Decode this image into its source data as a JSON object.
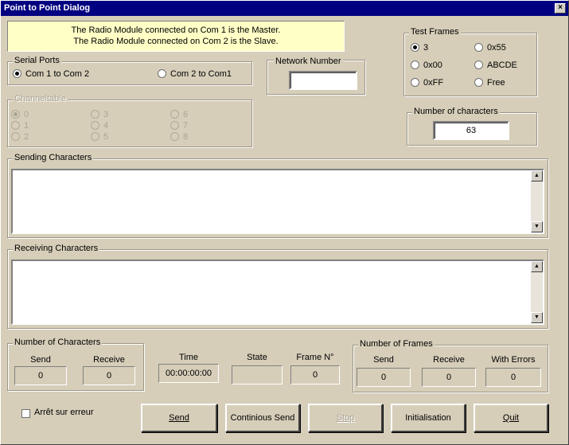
{
  "window": {
    "title": "Point to Point Dialog",
    "close_glyph": "×"
  },
  "info": {
    "line1": "The Radio Module connected on Com 1 is the Master.",
    "line2": "The Radio Module connected on Com 2 is the Slave."
  },
  "serial_ports": {
    "label": "Serial Ports",
    "options": [
      {
        "label": "Com 1 to Com 2",
        "selected": true
      },
      {
        "label": "Com 2 to Com1",
        "selected": false
      }
    ]
  },
  "network_number": {
    "label": "Network Number",
    "value": ""
  },
  "channel_table": {
    "label": "Channeltable",
    "enabled": false,
    "options": [
      "0",
      "1",
      "2",
      "3",
      "4",
      "5",
      "6",
      "7",
      "8"
    ],
    "selected": "0"
  },
  "test_frames": {
    "label": "Test Frames",
    "options": [
      "3",
      "0x55",
      "0x00",
      "ABCDE",
      "0xFF",
      "Free"
    ],
    "selected": "3"
  },
  "number_of_characters_field": {
    "label": "Number of characters",
    "value": "63"
  },
  "sending": {
    "label": "Sending Characters",
    "value": ""
  },
  "receiving": {
    "label": "Receiving Characters",
    "value": ""
  },
  "char_counts": {
    "label": "Number of Characters",
    "send_label": "Send",
    "send_value": "0",
    "receive_label": "Receive",
    "receive_value": "0"
  },
  "status": {
    "time_label": "Time",
    "time_value": "00:00:00:00",
    "state_label": "State",
    "state_value": "",
    "frame_label": "Frame N°",
    "frame_value": "0"
  },
  "frame_counts": {
    "label": "Number of Frames",
    "send_label": "Send",
    "send_value": "0",
    "receive_label": "Receive",
    "receive_value": "0",
    "errors_label": "With Errors",
    "errors_value": "0"
  },
  "stop_on_error": {
    "label": "Arrêt sur erreur",
    "checked": false
  },
  "buttons": {
    "send": "Send",
    "continuous": "Continious Send",
    "stop": "Stop",
    "init": "Initialisation",
    "quit": "Quit"
  },
  "icons": {
    "scroll_up": "▲",
    "scroll_down": "▼"
  }
}
